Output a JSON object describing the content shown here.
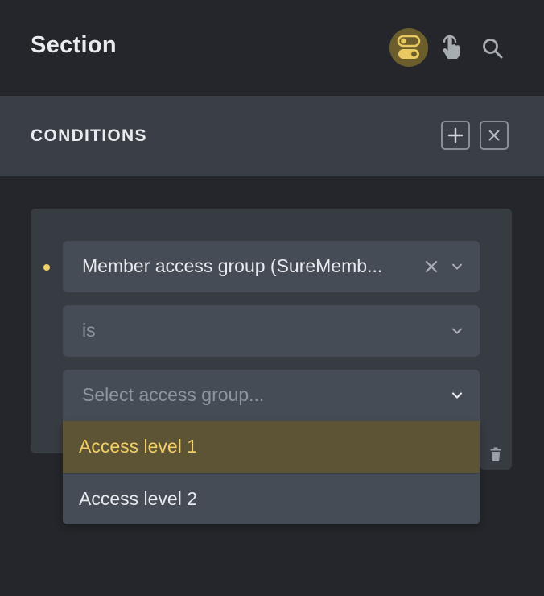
{
  "header": {
    "title": "Section",
    "icons": [
      "toggle-icon",
      "touch-icon",
      "search-icon"
    ]
  },
  "conditions": {
    "title": "CONDITIONS",
    "add_icon": "plus-icon",
    "close_icon": "close-icon"
  },
  "condition": {
    "key_value": "Member access group (SureMemb...",
    "operator_value": "is",
    "value_placeholder": "Select access group...",
    "options": [
      {
        "label": "Access level 1",
        "highlighted": true
      },
      {
        "label": "Access level 2",
        "highlighted": false
      }
    ]
  },
  "colors": {
    "background": "#24262b",
    "panel": "#3a3f47",
    "card": "#373b42",
    "field": "#464c55",
    "accent": "#f2cf67",
    "accent_bg": "#5d5436"
  }
}
